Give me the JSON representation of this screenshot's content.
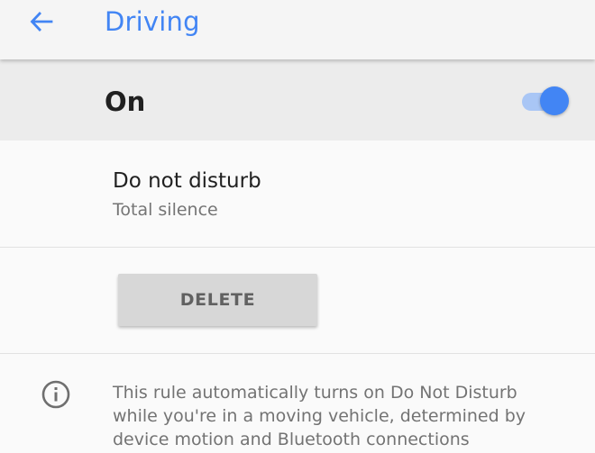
{
  "toolbar": {
    "title": "Driving",
    "back_icon": "arrow-back-icon",
    "accent_color": "#4285f4"
  },
  "master_switch": {
    "label": "On",
    "checked": true,
    "toggle_icon": "toggle-switch-on"
  },
  "dnd_preference": {
    "title": "Do not disturb",
    "summary": "Total silence"
  },
  "delete_button": {
    "label": "DELETE"
  },
  "info": {
    "icon": "info-icon",
    "lines": [
      "This rule automatically turns on Do Not Disturb",
      "while you're in a moving vehicle, determined by",
      "device motion and Bluetooth connections"
    ]
  }
}
